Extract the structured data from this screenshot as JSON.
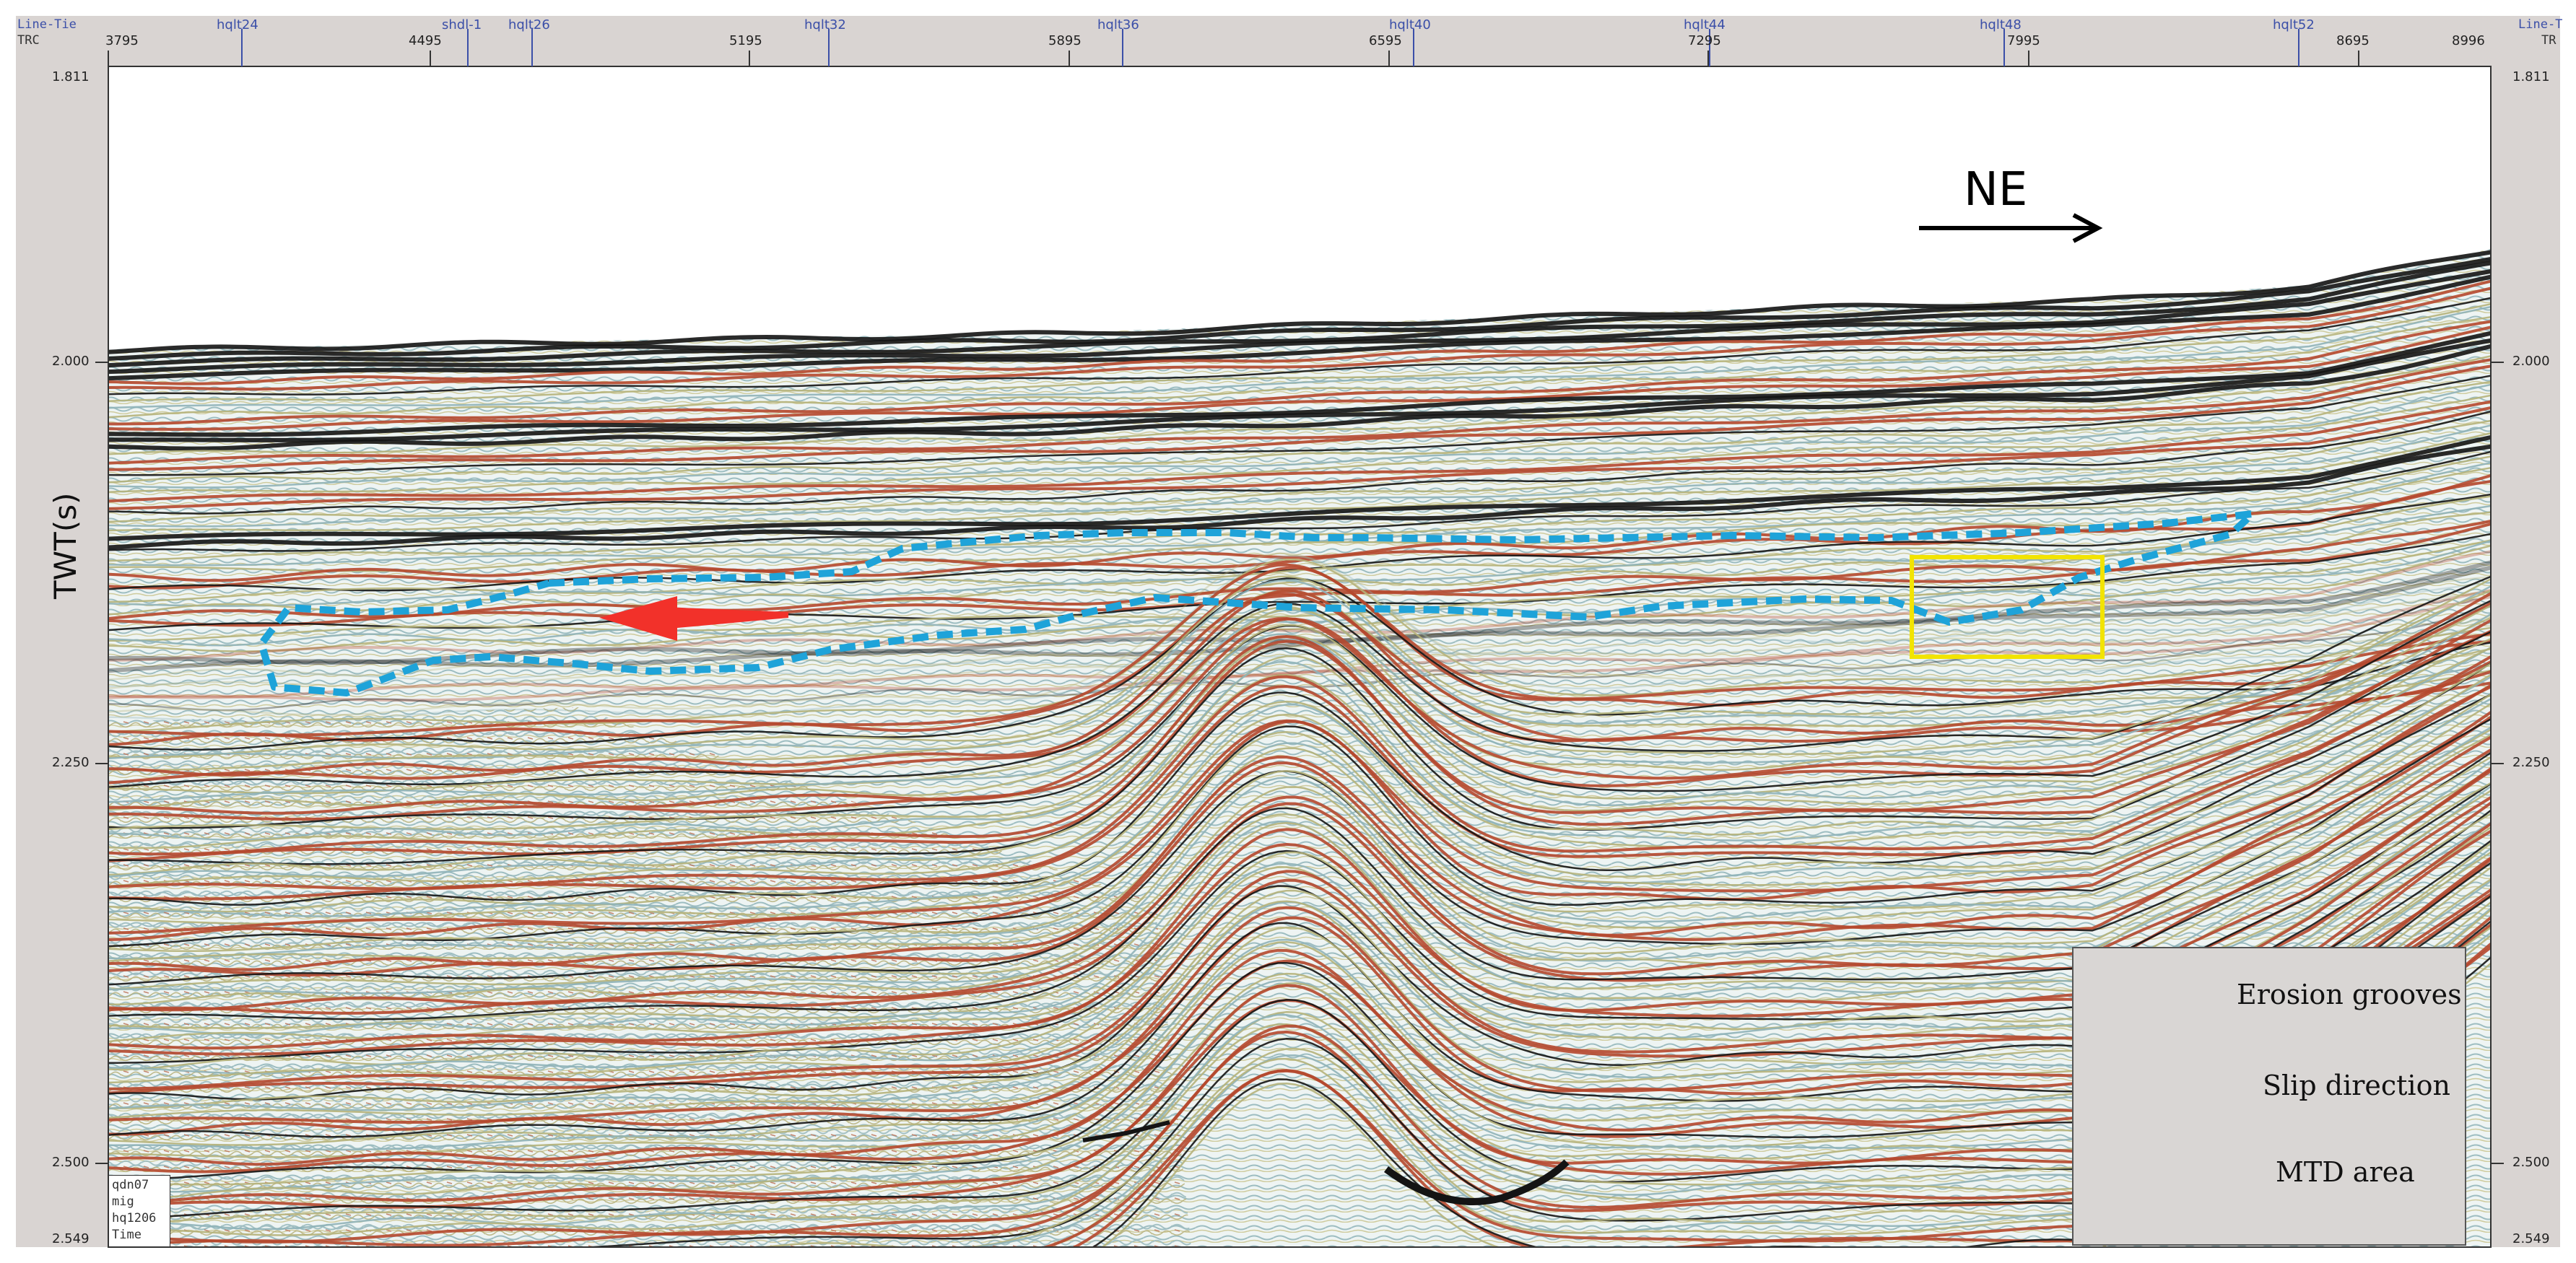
{
  "header": {
    "line_tie_left": "Line-Tie",
    "trc_label": "TRC",
    "line_tie_right": "Line-T",
    "tr_right": "TR",
    "trace_numbers": [
      "3795",
      "4495",
      "5195",
      "5895",
      "6595",
      "7295",
      "7995",
      "8695",
      "8996"
    ],
    "wells": [
      "hqlt24",
      "shdl-1",
      "hqlt26",
      "hqlt32",
      "hqlt36",
      "hqlt40",
      "hqlt44",
      "hqlt48",
      "hqlt52"
    ]
  },
  "time_axis": {
    "label": "TWT(s)",
    "ticks_left": [
      "1.811",
      "2.000",
      "2.250",
      "2.500",
      "2.549"
    ],
    "ticks_right": [
      "1.811",
      "2.000",
      "2.250",
      "2.500",
      "2.549"
    ]
  },
  "direction": {
    "label": "NE"
  },
  "info_box": {
    "lines": [
      "qdn07",
      "mig",
      "hq1206",
      "Time"
    ]
  },
  "legend": {
    "items": [
      {
        "label": "Erosion grooves",
        "color": "#f2e400"
      },
      {
        "label": "Slip direction",
        "color": "#f2312a"
      },
      {
        "label": "MTD area",
        "color": "#1ea3d9"
      }
    ]
  },
  "colors": {
    "reflector_red": "#b5482e",
    "reflector_black": "#141414",
    "reflector_olive": "#b5b27a",
    "mtd_outline": "#1ea3d9",
    "groove_box": "#f2e400",
    "slip_arrow": "#f2312a"
  }
}
